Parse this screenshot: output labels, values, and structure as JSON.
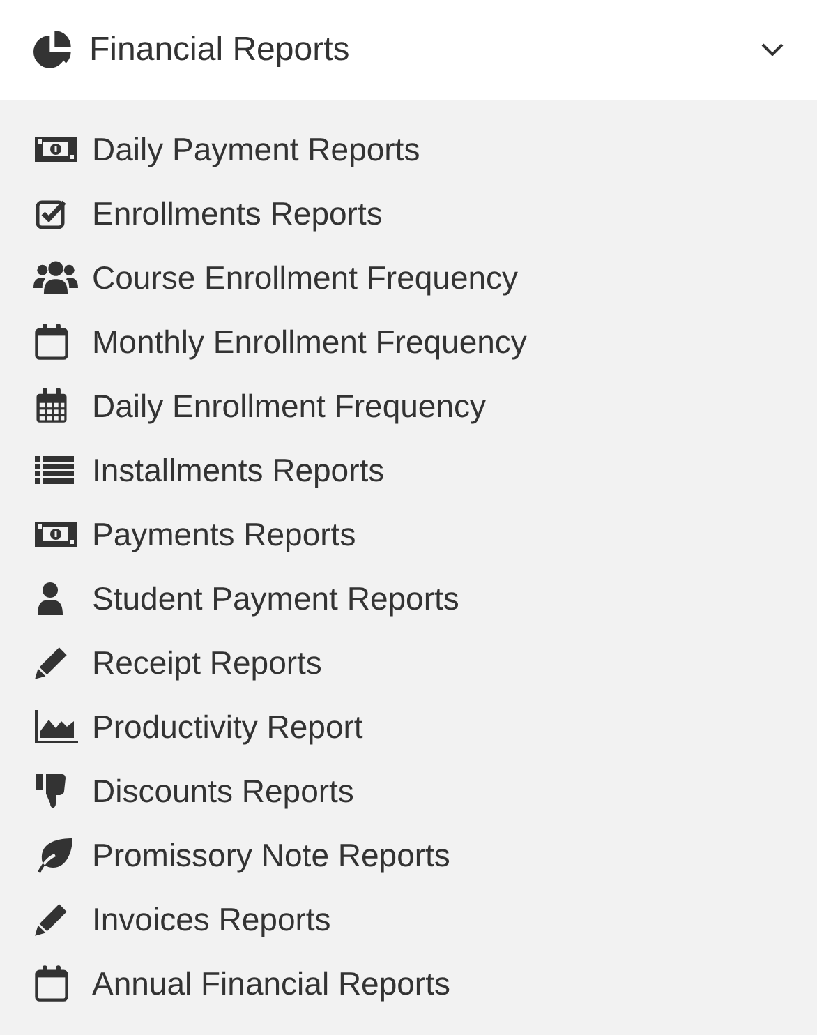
{
  "section": {
    "title": "Financial Reports",
    "expanded": true
  },
  "items": [
    {
      "label": "Daily Payment Reports",
      "kind": "money"
    },
    {
      "label": "Enrollments Reports",
      "kind": "check"
    },
    {
      "label": "Course Enrollment Frequency",
      "kind": "users"
    },
    {
      "label": "Monthly Enrollment Frequency",
      "kind": "calendar"
    },
    {
      "label": "Daily Enrollment Frequency",
      "kind": "grid"
    },
    {
      "label": "Installments Reports",
      "kind": "list"
    },
    {
      "label": "Payments Reports",
      "kind": "money"
    },
    {
      "label": "Student Payment Reports",
      "kind": "user"
    },
    {
      "label": "Receipt Reports",
      "kind": "pencil"
    },
    {
      "label": "Productivity Report",
      "kind": "area"
    },
    {
      "label": "Discounts Reports",
      "kind": "thumb"
    },
    {
      "label": "Promissory Note Reports",
      "kind": "leaf"
    },
    {
      "label": "Invoices Reports",
      "kind": "pencil"
    },
    {
      "label": "Annual Financial Reports",
      "kind": "calendar"
    }
  ]
}
